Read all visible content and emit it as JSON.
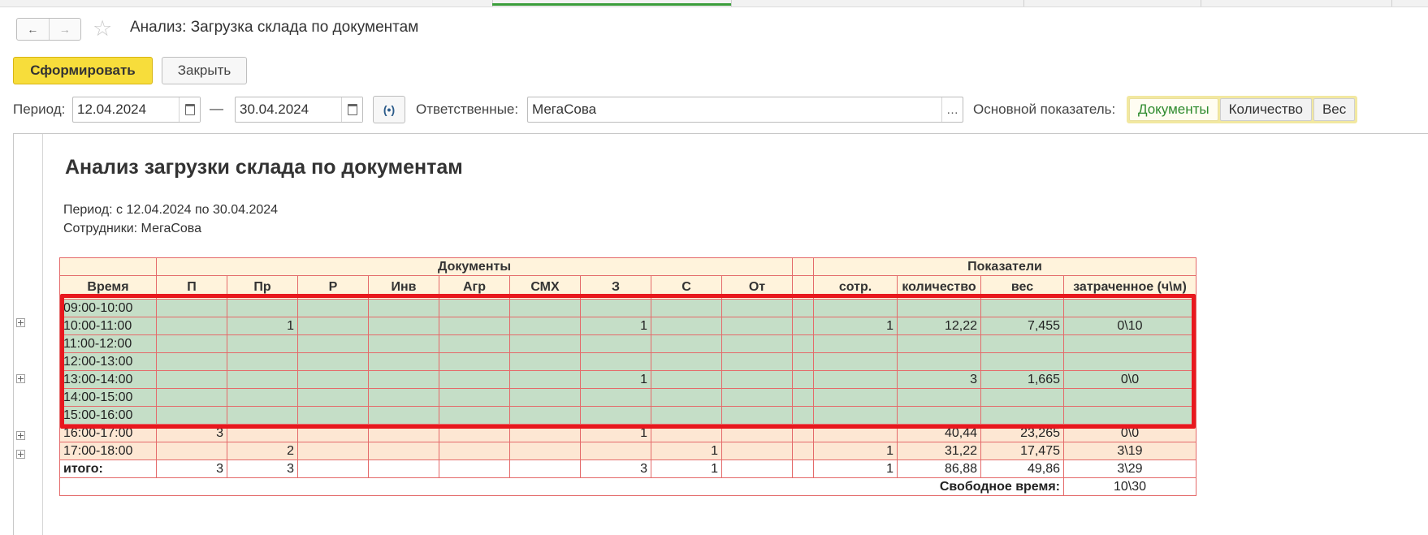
{
  "window": {
    "title": "Анализ: Загрузка склада по документам"
  },
  "toolbar": {
    "generate_label": "Сформировать",
    "close_label": "Закрыть"
  },
  "filters": {
    "period_label": "Период:",
    "date_from": "12.04.2024",
    "dash": "—",
    "date_to": "30.04.2024",
    "responsible_label": "Ответственные:",
    "responsible_value": "МегаСова",
    "indicator_label": "Основной показатель:",
    "indicator_options": [
      "Документы",
      "Количество",
      "Вес"
    ],
    "indicator_selected": "Документы"
  },
  "report": {
    "title": "Анализ загрузки склада по документам",
    "period_line": "Период: с 12.04.2024 по 30.04.2024",
    "employees_line": "Сотрудники: МегаСова",
    "header_group_docs": "Документы",
    "header_group_metrics": "Показатели",
    "header_time": "Время",
    "doc_columns": [
      "П",
      "Пр",
      "Р",
      "Инв",
      "Агр",
      "СМХ",
      "З",
      "С",
      "От"
    ],
    "metric_columns": [
      "сотр.",
      "количество",
      "вес",
      "затраченное (ч\\м)"
    ],
    "rows": [
      {
        "time": "09:00-10:00",
        "style": "grn",
        "docs": [
          "",
          "",
          "",
          "",
          "",
          "",
          "",
          "",
          ""
        ],
        "metrics": [
          "",
          "",
          "",
          ""
        ]
      },
      {
        "time": "10:00-11:00",
        "style": "grn",
        "docs": [
          "",
          "1",
          "",
          "",
          "",
          "",
          "1",
          "",
          ""
        ],
        "metrics": [
          "1",
          "12,22",
          "7,455",
          "0\\10"
        ]
      },
      {
        "time": "11:00-12:00",
        "style": "grn",
        "docs": [
          "",
          "",
          "",
          "",
          "",
          "",
          "",
          "",
          ""
        ],
        "metrics": [
          "",
          "",
          "",
          ""
        ]
      },
      {
        "time": "12:00-13:00",
        "style": "grn",
        "docs": [
          "",
          "",
          "",
          "",
          "",
          "",
          "",
          "",
          ""
        ],
        "metrics": [
          "",
          "",
          "",
          ""
        ]
      },
      {
        "time": "13:00-14:00",
        "style": "grn",
        "docs": [
          "",
          "",
          "",
          "",
          "",
          "",
          "1",
          "",
          ""
        ],
        "metrics": [
          "",
          "3",
          "1,665",
          "0\\0"
        ]
      },
      {
        "time": "14:00-15:00",
        "style": "grn",
        "docs": [
          "",
          "",
          "",
          "",
          "",
          "",
          "",
          "",
          ""
        ],
        "metrics": [
          "",
          "",
          "",
          ""
        ]
      },
      {
        "time": "15:00-16:00",
        "style": "grn",
        "docs": [
          "",
          "",
          "",
          "",
          "",
          "",
          "",
          "",
          ""
        ],
        "metrics": [
          "",
          "",
          "",
          ""
        ]
      },
      {
        "time": "16:00-17:00",
        "style": "org",
        "docs": [
          "3",
          "",
          "",
          "",
          "",
          "",
          "1",
          "",
          ""
        ],
        "metrics": [
          "",
          "40,44",
          "23,265",
          "0\\0"
        ]
      },
      {
        "time": "17:00-18:00",
        "style": "org",
        "docs": [
          "",
          "2",
          "",
          "",
          "",
          "",
          "",
          "1",
          ""
        ],
        "metrics": [
          "1",
          "31,22",
          "17,475",
          "3\\19"
        ]
      },
      {
        "time": "итого:",
        "style": "tot",
        "docs": [
          "3",
          "3",
          "",
          "",
          "",
          "",
          "3",
          "1",
          ""
        ],
        "metrics": [
          "1",
          "86,88",
          "49,86",
          "3\\29"
        ]
      }
    ],
    "free_time_label": "Свободное время:",
    "free_time_value": "10\\30"
  },
  "colors": {
    "primary_button": "#f7dd3b",
    "selected_option_text": "#2e8b2e",
    "grid_line": "#e46a6a",
    "row_green": "#c5dec7",
    "row_orange": "#fde7d3",
    "header_bg": "#fff3dc",
    "highlight_frame": "#e8181e"
  }
}
